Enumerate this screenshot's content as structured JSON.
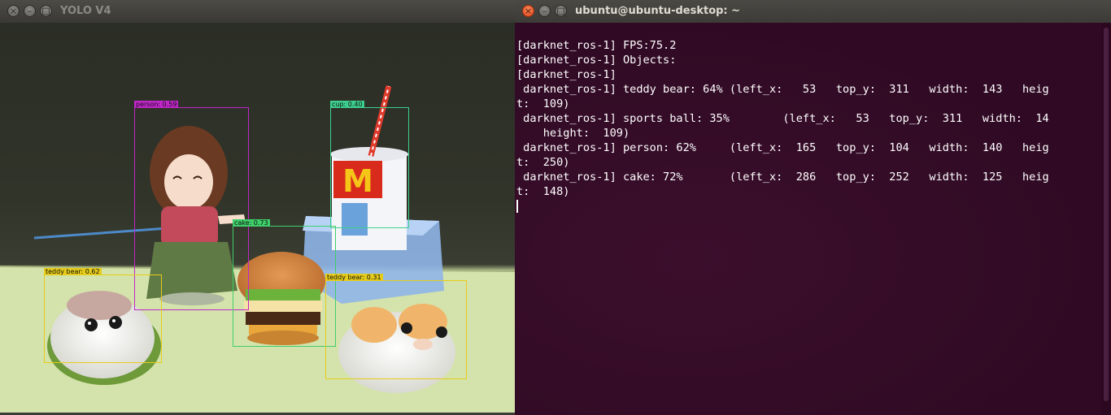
{
  "yolo_window": {
    "title": "YOLO V4",
    "buttons": {
      "close": "×",
      "minimize": "–",
      "maximize": "□"
    },
    "detections": [
      {
        "label": "person: 0.59",
        "color": "#c026c9"
      },
      {
        "label": "cup: 0.40",
        "color": "#3ecf8e"
      },
      {
        "label": "cake: 0.73",
        "color": "#3ecf6a"
      },
      {
        "label": "teddy bear: 0.62",
        "color": "#e6cc1a"
      },
      {
        "label": "teddy bear: 0.31",
        "color": "#e6cc1a"
      }
    ]
  },
  "terminal_window": {
    "title": "ubuntu@ubuntu-desktop: ~",
    "buttons": {
      "close": "×",
      "minimize": "–",
      "maximize": "□"
    },
    "lines": [
      "[darknet_ros-1] FPS:75.2",
      "[darknet_ros-1] Objects:",
      "[darknet_ros-1]",
      " darknet_ros-1] teddy bear: 64% (left_x:   53   top_y:  311   width:  143   heig",
      "t:  109)",
      " darknet_ros-1] sports ball: 35%        (left_x:   53   top_y:  311   width:  14",
      "    height:  109)",
      " darknet_ros-1] person: 62%     (left_x:  165   top_y:  104   width:  140   heig",
      "t:  250)",
      " darknet_ros-1] cake: 72%       (left_x:  286   top_y:  252   width:  125   heig",
      "t:  148)",
      ""
    ]
  }
}
